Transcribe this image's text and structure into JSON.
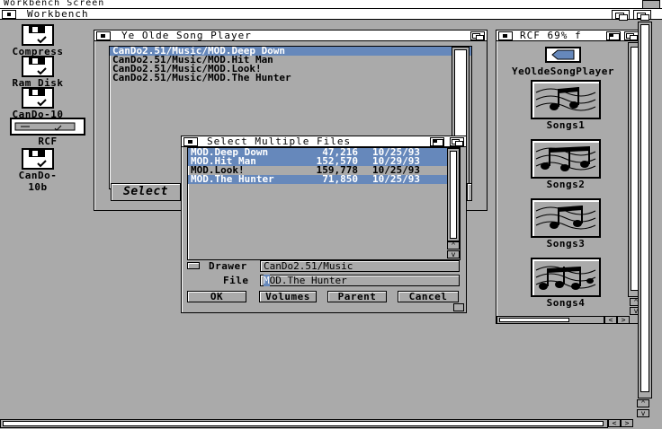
{
  "screen": {
    "title": "Workbench Screen"
  },
  "workbench": {
    "title": "Workbench"
  },
  "desktop_icons": [
    {
      "label": "Compress"
    },
    {
      "label": "Ram Disk"
    },
    {
      "label": "CanDo-10"
    },
    {
      "label": "RCF"
    },
    {
      "label": "CanDo-10b"
    }
  ],
  "song_player": {
    "title": "Ye Olde Song Player",
    "songs": [
      "CanDo2.51/Music/MOD.Deep Down",
      "CanDo2.51/Music/MOD.Hit Man",
      "CanDo2.51/Music/MOD.Look!",
      "CanDo2.51/Music/MOD.The Hunter"
    ],
    "selected_index": 0,
    "select_button": "Select"
  },
  "rcf": {
    "title": "RCF   69% f",
    "tool_label": "YeOldeSongPlayer",
    "drawers": [
      "Songs1",
      "Songs2",
      "Songs3",
      "Songs4"
    ]
  },
  "file_requester": {
    "title": "Select Multiple Files",
    "files": [
      {
        "name": "MOD.Deep Down",
        "size": "47,216",
        "date": "10/25/93"
      },
      {
        "name": "MOD.Hit Man",
        "size": "152,570",
        "date": "10/29/93"
      },
      {
        "name": "MOD.Look!",
        "size": "159,778",
        "date": "10/25/93"
      },
      {
        "name": "MOD.The Hunter",
        "size": "71,850",
        "date": "10/25/93"
      }
    ],
    "selected": [
      0,
      1,
      3
    ],
    "drawer_label": "Drawer",
    "drawer_value": "CanDo2.51/Music",
    "file_label": "File",
    "file_value_first": "M",
    "file_value_rest": "OD.The Hunter",
    "buttons": {
      "ok": "OK",
      "volumes": "Volumes",
      "parent": "Parent",
      "cancel": "Cancel"
    }
  },
  "colors": {
    "selection": "#6688bb",
    "background": "#aaaaaa",
    "highlight": "#ffffff"
  }
}
